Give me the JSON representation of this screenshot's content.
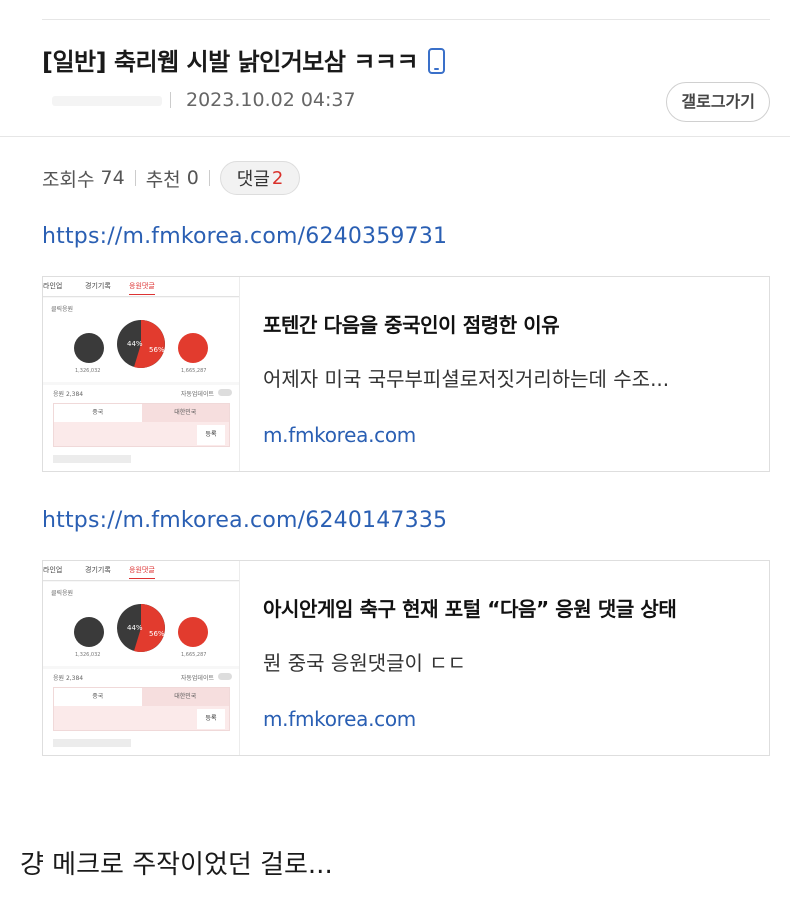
{
  "post": {
    "title": "[일반] 축리웹 시발 낡인거보삼 ㅋㅋㅋ",
    "date": "2023.10.02 04:37",
    "gallery_button": "갤로그가기"
  },
  "stats": {
    "views_label": "조회수",
    "views": "74",
    "recommend_label": "추천",
    "recommend": "0",
    "comments_label": "댓글",
    "comments": "2"
  },
  "links": [
    {
      "url": "https://m.fmkorea.com/6240359731",
      "title": "포텐간 다음을 중국인이 점령한 이유",
      "description": "어제자 미국 국무부피셜로저짓거리하는데 수조...",
      "domain": "m.fmkorea.com"
    },
    {
      "url": "https://m.fmkorea.com/6240147335",
      "title": "아시안게임 축구 현재 포털 “다음” 응원 댓글 상태",
      "description": "뭔 중국 응원댓글이 ㄷㄷ",
      "domain": "m.fmkorea.com"
    }
  ],
  "thumbnail": {
    "tab_1": "라인업",
    "tab_2": "경기기록",
    "tab_3": "응원댓글",
    "panel_label": "클릭응원",
    "china_pct": "44%",
    "korea_pct": "56%",
    "china_count": "1,326,032",
    "korea_count": "1,665,287",
    "comment_count": "응원 2,384",
    "toggle_label": "자동업데이트",
    "left_tab": "중국",
    "right_tab": "대한민국",
    "submit": "등록"
  },
  "footer": "걍 메크로 주작이었던 걸로...",
  "colors": {
    "link": "#2a5fb3",
    "accent_red": "#d9302a",
    "icon_blue": "#3a70c9"
  }
}
